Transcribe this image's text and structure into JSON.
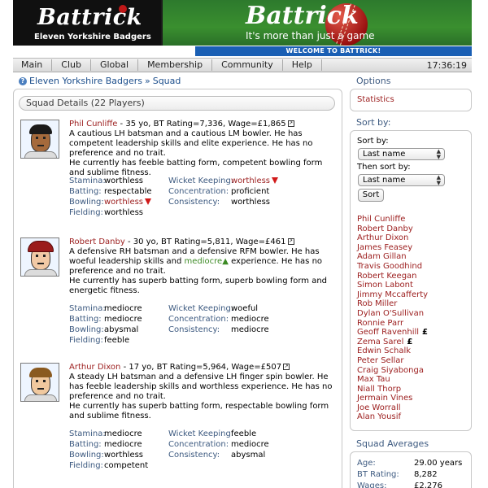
{
  "banner": {
    "left_logo_title": "Battrick",
    "team_name": "Eleven Yorkshire Badgers",
    "right_logo_title": "Battrick",
    "tagline": "It's more than just a game",
    "welcome": "WELCOME TO BATTRICK!"
  },
  "nav": {
    "items": [
      "Main",
      "Club",
      "Global",
      "Membership",
      "Community",
      "Help"
    ],
    "clock": "17:36:19"
  },
  "breadcrumb": {
    "icon": "info-icon",
    "club": "Eleven Yorkshire Badgers",
    "separator": "»",
    "page": "Squad"
  },
  "squad": {
    "title": "Squad Details (22 Players)",
    "labels": {
      "stamina": "Stamina:",
      "batting": "Batting:",
      "bowling": "Bowling:",
      "fielding": "Fielding:",
      "keeping": "Wicket Keeping:",
      "concentration": "Concentration:",
      "consistency": "Consistency:"
    },
    "players": [
      {
        "name": "Phil Cunliffe",
        "meta": " - 35 yo, BT Rating=7,336, Wage=£1,865",
        "desc_a": "A cautious LH batsman and a cautious LM bowler. He has competent leadership skills and elite experience. He has no preference and no trait.",
        "desc_b": "He currently has feeble batting form, competent bowling form and sublime fitness.",
        "stamina": "worthless",
        "batting": "respectable",
        "bowling": "worthless",
        "fielding": "worthless",
        "keeping": "worthless",
        "concentration": "proficient",
        "consistency": "worthless"
      },
      {
        "name": "Robert Danby",
        "meta": " - 30 yo, BT Rating=5,811, Wage=£461",
        "desc_pre": "A defensive RH batsman and a defensive RFM bowler. He has woeful leadership skills and ",
        "desc_green": "mediocre",
        "desc_post": " experience. He has no preference and no trait.",
        "desc_b": "He currently has superb batting form, superb bowling form and energetic fitness.",
        "stamina": "mediocre",
        "batting": "mediocre",
        "bowling": "abysmal",
        "fielding": "feeble",
        "keeping": "woeful",
        "concentration": "mediocre",
        "consistency": "mediocre"
      },
      {
        "name": "Arthur Dixon",
        "meta": " - 17 yo, BT Rating=5,964, Wage=£507",
        "desc_a": "A steady LH batsman and a defensive LH finger spin bowler. He has feeble leadership skills and worthless experience. He has no preference and no trait.",
        "desc_b": "He currently has superb batting form, respectable bowling form and sublime fitness.",
        "stamina": "mediocre",
        "batting": "mediocre",
        "bowling": "worthless",
        "fielding": "competent",
        "keeping": "feeble",
        "concentration": "mediocre",
        "consistency": "abysmal"
      }
    ]
  },
  "sidebar": {
    "options_heading": "Options",
    "statistics_link": "Statistics",
    "sortby_heading": "Sort by:",
    "sort_by_label": "Sort by:",
    "then_sort_label": "Then sort by:",
    "sort_primary": "Last name",
    "sort_secondary": "Last name",
    "sort_button": "Sort",
    "player_list": [
      "Phil Cunliffe",
      "Robert Danby",
      "Arthur Dixon",
      "James Feasey",
      "Adam Gillan",
      "Travis Goodhind",
      "Robert Keegan",
      "Simon Labont",
      "Jimmy Mccafferty",
      "Rob Miller",
      "Dylan O'Sullivan",
      "Ronnie Parr",
      "Geoff Ravenhill",
      "Zema Sarel",
      "Edwin Schalk",
      "Peter Sellar",
      "Craig Siyabonga",
      "Max Tau",
      "Niall Thorp",
      "Jermain Vines",
      "Joe Worrall",
      "Alan Yousif"
    ],
    "pound_marker": "£",
    "averages_heading": "Squad Averages",
    "averages": [
      {
        "label": "Age:",
        "value": "29.00 years"
      },
      {
        "label": "BT Rating:",
        "value": "8,282"
      },
      {
        "label": "Wages:",
        "value": "£2,276"
      }
    ]
  },
  "colors": {
    "link_red": "#9b1c1c",
    "label_blue": "#3d5a80",
    "welcome_blue": "#1a5fb4",
    "down_arrow": "#d11a1a"
  }
}
